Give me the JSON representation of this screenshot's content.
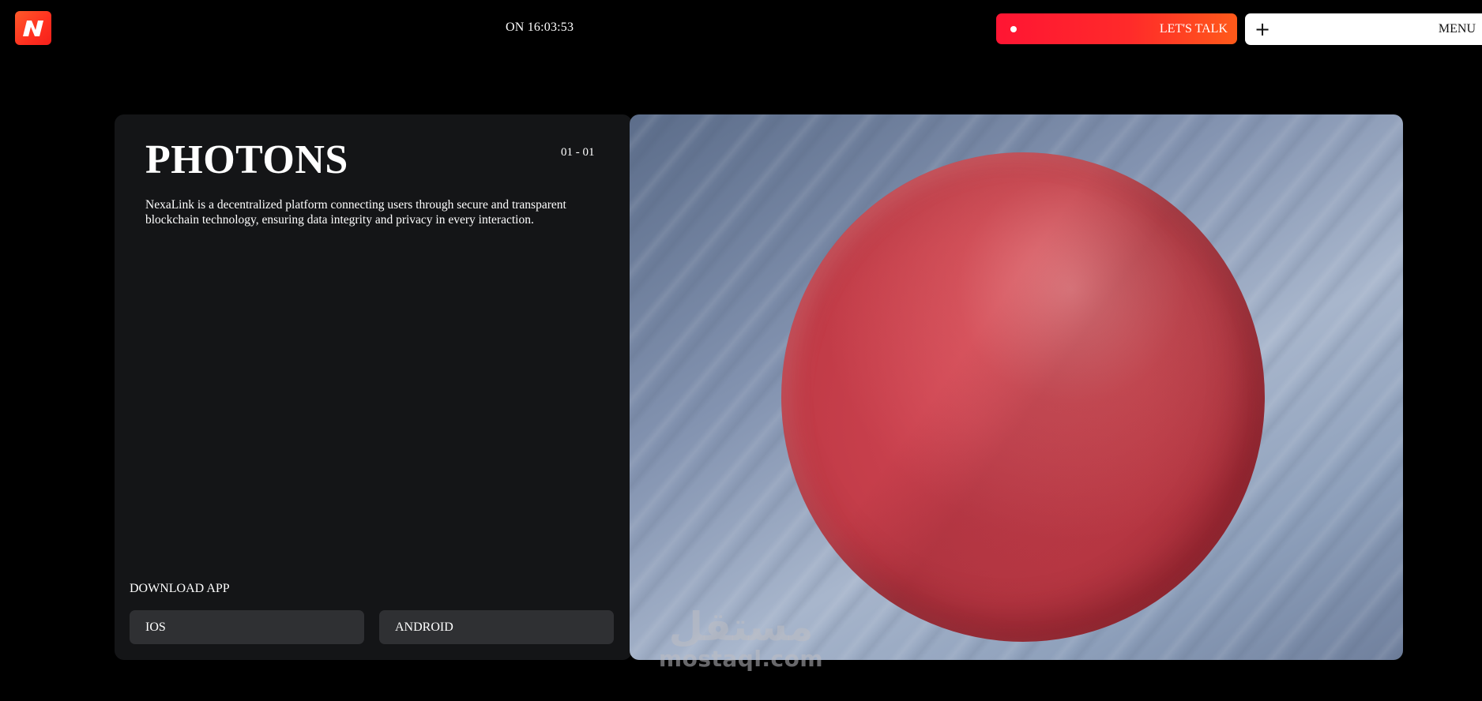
{
  "header": {
    "logo_letter": "N",
    "clock_text": "ON 16:03:53",
    "cta_label": "LET'S TALK",
    "menu_label": "MENU",
    "menu_icon": "plus-icon"
  },
  "panel": {
    "title": "PHOTONS",
    "counter": "01 - 01",
    "description": "NexaLink is a decentralized platform connecting users through secure and transparent blockchain technology, ensuring data integrity and privacy in every interaction.",
    "download_label": "DOWNLOAD APP",
    "stores": [
      {
        "label": "IOS"
      },
      {
        "label": "ANDROID"
      }
    ]
  },
  "hero": {
    "subject": "red-sphere"
  },
  "watermark": {
    "arabic": "مستقل",
    "latin": "mostaql.com"
  },
  "colors": {
    "background": "#000000",
    "panel": "#141517",
    "store_button": "#2f3033",
    "cta_gradient_start": "#ff1533",
    "cta_gradient_end": "#ff5a1a",
    "logo": "#ff3a20",
    "sphere": "#c13b47"
  }
}
